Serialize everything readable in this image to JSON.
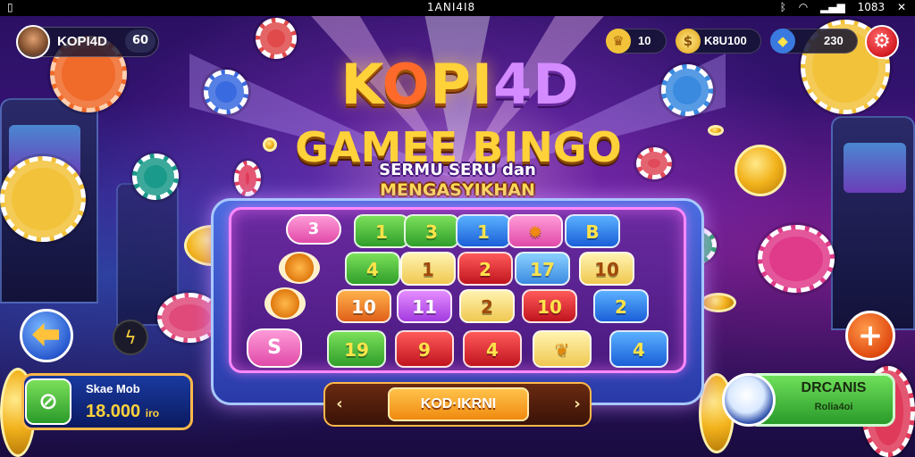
{
  "status_bar": {
    "left_icon": "sim-icon",
    "center_text": "1ANI4I8",
    "right_items": [
      "bluetooth-icon",
      "wifi-icon",
      "signal-icon",
      "1083",
      "close-icon"
    ],
    "time": "1083"
  },
  "profile": {
    "name": "KOPI4D",
    "level": "60"
  },
  "hud": {
    "badge_value": "10",
    "coins_value": "K8U100",
    "gems_value": "230"
  },
  "title": {
    "main_prefix": "K",
    "main_o": "O",
    "main_rest": "PI",
    "main_accent": "4D",
    "sub": "GAMEE BINGO",
    "tagline1": "SERMU SERU dan",
    "tagline2": "MENGASYIKHAN"
  },
  "board": {
    "left_column": [
      "3",
      "",
      "",
      "S"
    ],
    "rows": [
      [
        "1",
        "3",
        "1",
        "",
        "B"
      ],
      [
        "4",
        "1",
        "2",
        "17",
        "10"
      ],
      [
        "10",
        "11",
        "2",
        "10",
        "2"
      ],
      [
        "19",
        "9",
        "4",
        "",
        "4"
      ]
    ]
  },
  "cta": {
    "label": "KOD·IKRNI"
  },
  "balance": {
    "label": "Skae Mob",
    "value": "18.000",
    "unit": "iro"
  },
  "right_card": {
    "label": "DRCANIS",
    "sub": "Rolia4oi"
  },
  "colors": {
    "accent_gold": "#ffd23a",
    "accent_purple": "#d48bff",
    "board_border": "#ff88ff"
  }
}
